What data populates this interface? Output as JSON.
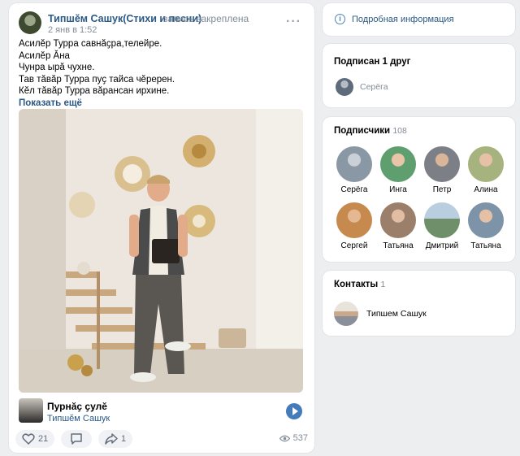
{
  "post": {
    "author": "Типшӗм Сашук(Стихи и песни)",
    "note": "запись закреплена",
    "date": "2 янв в 1:52",
    "lines": [
      "Асилӗр Турра савнӑҫра,телейре.",
      "Асилӗр Ӑна",
      "Чунра ырӑ чухне.",
      "Тав тӑвӑр Турра пуҫ тайса чӗререн.",
      "Кӗл тӑвӑр Турра вӑрансан ирхине."
    ],
    "show_more": "Показать ещё",
    "audio": {
      "title": "Пурнӑҫ ҫулӗ",
      "artist": "Типшӗм Сашук"
    },
    "likes": "21",
    "shares": "1",
    "views": "537"
  },
  "info": {
    "label": "Подробная информация"
  },
  "friends": {
    "title": "Подписан 1 друг",
    "items": [
      {
        "name": "Серёга"
      }
    ]
  },
  "subscribers": {
    "title": "Подписчики",
    "count": "108",
    "items": [
      {
        "name": "Серёга",
        "color": "#8a98a6"
      },
      {
        "name": "Инга",
        "color": "#5f9e6e"
      },
      {
        "name": "Петр",
        "color": "#7d7f86"
      },
      {
        "name": "Алина",
        "color": "#a6b37f"
      },
      {
        "name": "Сергей",
        "color": "#c78a4e"
      },
      {
        "name": "Татьяна",
        "color": "#9c7f6b"
      },
      {
        "name": "Дмитрий",
        "color": "#6f8f6a"
      },
      {
        "name": "Татьяна",
        "color": "#7c93a8"
      }
    ]
  },
  "contacts": {
    "title": "Контакты",
    "count": "1",
    "items": [
      {
        "name": "Типшем Сашук"
      }
    ]
  }
}
